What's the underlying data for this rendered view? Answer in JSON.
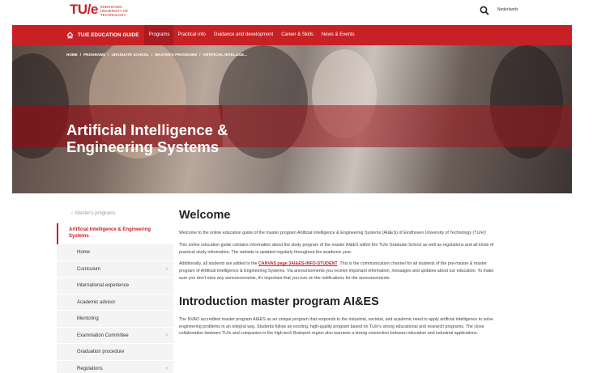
{
  "brand": {
    "logo_text": "TU/e",
    "logo_sub": "Eindhoven University of Technology"
  },
  "topbar": {
    "language": "Nederlands",
    "search_icon": "search-icon"
  },
  "nav": {
    "home_label": "TU/E EDUCATION GUIDE",
    "items": [
      "Programs",
      "Practical info",
      "Guidance and development",
      "Career & Skills",
      "News & Events"
    ],
    "active_index": 0,
    "accent": "#c72125"
  },
  "hero": {
    "breadcrumb": [
      "HOME",
      "PROGRAMS",
      "GRADUATE SCHOOL",
      "MASTER'S PROGRAMS",
      "ARTIFICIAL INTELLIGE..."
    ],
    "title": "Artificial Intelligence & Engineering Systems"
  },
  "sidebar": {
    "back_label": "Master's programs",
    "current": "Artificial Intelligence & Engineering Systems",
    "items": [
      {
        "label": "Home",
        "has_children": false
      },
      {
        "label": "Curriculum",
        "has_children": true
      },
      {
        "label": "International experience",
        "has_children": false
      },
      {
        "label": "Academic advisor",
        "has_children": false
      },
      {
        "label": "Mentoring",
        "has_children": false
      },
      {
        "label": "Examination Committee",
        "has_children": true
      },
      {
        "label": "Graduation procedure",
        "has_children": false
      },
      {
        "label": "Regulations",
        "has_children": true
      }
    ]
  },
  "main": {
    "welcome_heading": "Welcome",
    "p1": "Welcome to the online education guide of the master program Artificial Intelligence & Engineering Systems (AI&ES) of Eindhoven University of Technology (TU/e)!",
    "p2": "This online education guide contains information about the study program of the master AI&ES within the TU/e Graduate School as well as regulations and all kinds of practical study information. The website is updated regularly throughout the academic year.",
    "p3_before": "Additionally, all students are added to the ",
    "p3_link": "CANVAS page 3AI&ES-INFO-STUDENT",
    "p3_after": ". This is the communication channel for all students of the pre-master & master program of Artificial Intelligence & Engineering Systems. Via announcements you receive important information, messages and updates about our education. To make sure you don't miss any announcements, it's important that you turn on the notifications for the announcements.",
    "intro_heading": "Introduction master program AI&ES",
    "p4": "The NVAO accredited master program AI&ES as an unique program that responds to the industrial, societal, and academic need to apply artificial intelligence to solve engineering problems in an integral way. Students follow an exciting, high-quality program based on TU/e's strong educational and research programs. The close collaboration between TU/e and companies in the high-tech Brainport region also warrants a strong connection between education and industrial applications."
  }
}
